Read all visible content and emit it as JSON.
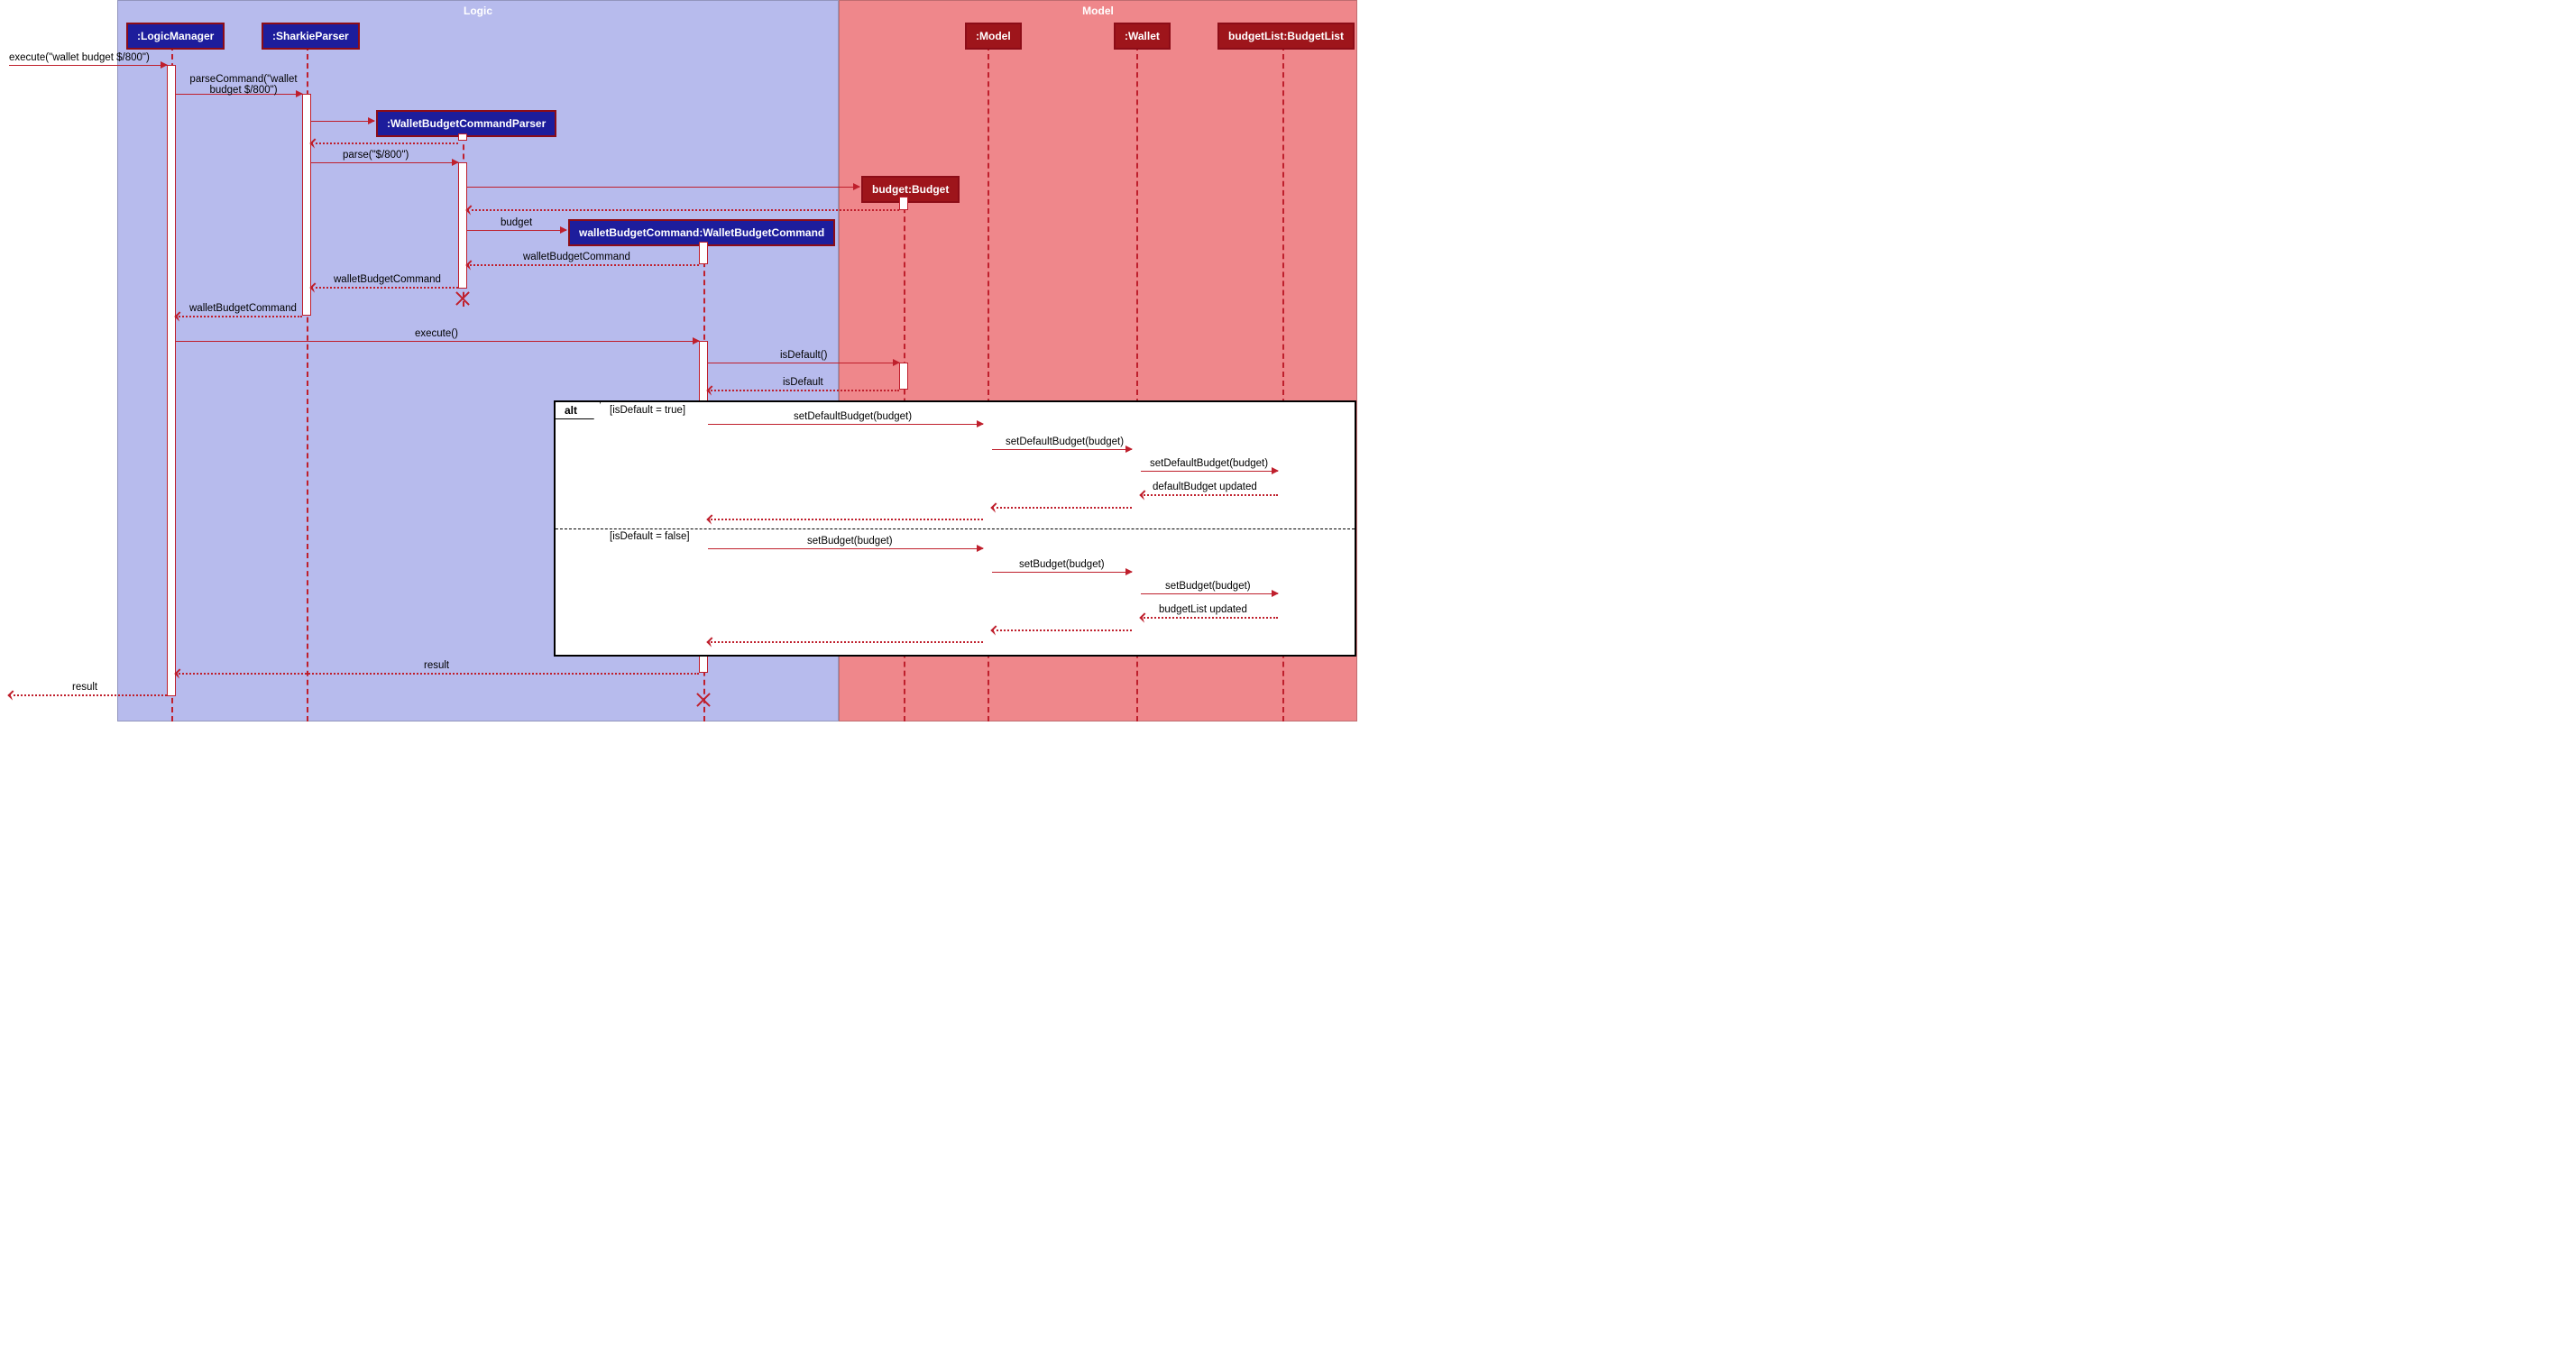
{
  "regions": {
    "logic": "Logic",
    "model": "Model"
  },
  "participants": {
    "logicManager": ":LogicManager",
    "sharkieParser": ":SharkieParser",
    "walletBudgetCommandParser": ":WalletBudgetCommandParser",
    "walletBudgetCommand": "walletBudgetCommand:WalletBudgetCommand",
    "budget": "budget:Budget",
    "model": ":Model",
    "wallet": ":Wallet",
    "budgetList": "budgetList:BudgetList"
  },
  "messages": {
    "executeIn": "execute(\"wallet budget $/800\")",
    "parseCommand": "parseCommand(\"wallet budget $/800\")",
    "parse": "parse(\"$/800\")",
    "budget": "budget",
    "walletBudgetCommandReturn": "walletBudgetCommand",
    "execute": "execute()",
    "isDefault": "isDefault()",
    "isDefaultReturn": "isDefault",
    "setDefaultBudget": "setDefaultBudget(budget)",
    "defaultBudgetUpdated": "defaultBudget updated",
    "setBudget": "setBudget(budget)",
    "budgetListUpdated": "budgetList updated",
    "result": "result"
  },
  "alt": {
    "label": "alt",
    "guardTrue": "[isDefault = true]",
    "guardFalse": "[isDefault = false]"
  }
}
